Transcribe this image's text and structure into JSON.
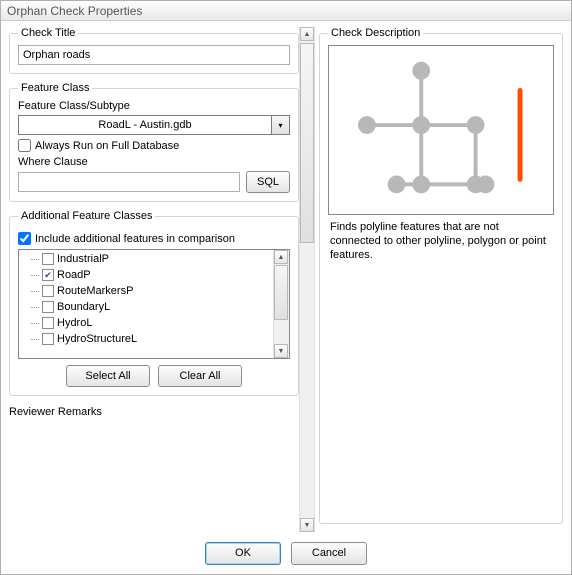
{
  "window": {
    "title": "Orphan Check Properties"
  },
  "check_title": {
    "legend": "Check Title",
    "value": "Orphan roads"
  },
  "feature_class": {
    "legend": "Feature Class",
    "subtype_label": "Feature Class/Subtype",
    "selected": "RoadL -  Austin.gdb",
    "always_run_label": "Always Run on Full Database",
    "always_run_checked": false,
    "where_label": "Where Clause",
    "where_value": "",
    "sql_label": "SQL"
  },
  "additional": {
    "legend": "Additional Feature Classes",
    "include_label": "Include additional features in comparison",
    "include_checked": true,
    "items": [
      {
        "label": "IndustrialP",
        "checked": false
      },
      {
        "label": "RoadP",
        "checked": true
      },
      {
        "label": "RouteMarkersP",
        "checked": false
      },
      {
        "label": "BoundaryL",
        "checked": false
      },
      {
        "label": "HydroL",
        "checked": false
      },
      {
        "label": "HydroStructureL",
        "checked": false
      }
    ],
    "select_all": "Select All",
    "clear_all": "Clear All"
  },
  "reviewer_remarks_label": "Reviewer Remarks",
  "description": {
    "legend": "Check Description",
    "text": "Finds polyline features that are not connected to other polyline, polygon or point features."
  },
  "buttons": {
    "ok": "OK",
    "cancel": "Cancel"
  },
  "colors": {
    "accent": "#ff4d00",
    "node": "#b8b8b8",
    "edge": "#b8b8b8"
  }
}
